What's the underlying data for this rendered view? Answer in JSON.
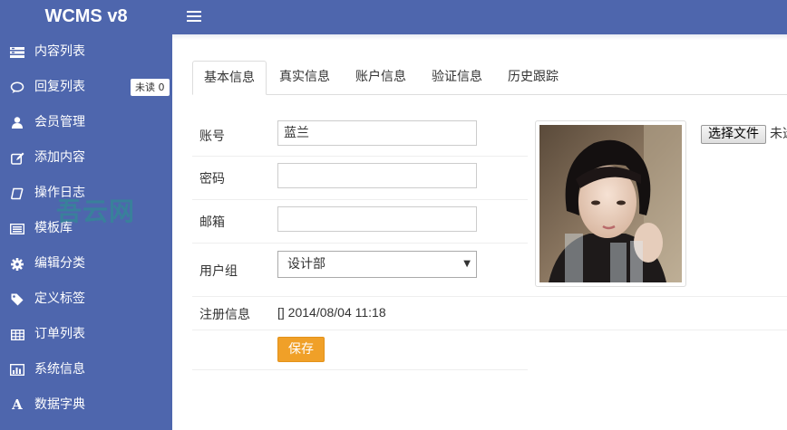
{
  "app": {
    "title": "WCMS v8"
  },
  "sidebar": {
    "items": [
      {
        "label": "内容列表",
        "icon": "list-icon"
      },
      {
        "label": "回复列表",
        "icon": "comment-icon",
        "badge": "未读 0"
      },
      {
        "label": "会员管理",
        "icon": "user-icon"
      },
      {
        "label": "添加内容",
        "icon": "edit-icon"
      },
      {
        "label": "操作日志",
        "icon": "log-icon"
      },
      {
        "label": "模板库",
        "icon": "template-icon"
      },
      {
        "label": "编辑分类",
        "icon": "gear-icon"
      },
      {
        "label": "定义标签",
        "icon": "tag-icon"
      },
      {
        "label": "订单列表",
        "icon": "table-icon"
      },
      {
        "label": "系统信息",
        "icon": "bar-chart-icon"
      },
      {
        "label": "数据字典",
        "icon": "font-icon"
      }
    ]
  },
  "watermark": "吾云网",
  "tabs": [
    {
      "label": "基本信息",
      "active": true
    },
    {
      "label": "真实信息",
      "active": false
    },
    {
      "label": "账户信息",
      "active": false
    },
    {
      "label": "验证信息",
      "active": false
    },
    {
      "label": "历史跟踪",
      "active": false
    }
  ],
  "form": {
    "account": {
      "label": "账号",
      "value": "蓝兰"
    },
    "password": {
      "label": "密码",
      "value": ""
    },
    "email": {
      "label": "邮箱",
      "value": ""
    },
    "group": {
      "label": "用户组",
      "value": "设计部"
    },
    "register": {
      "label": "注册信息",
      "value": "[] 2014/08/04 11:18"
    },
    "save_label": "保存"
  },
  "upload": {
    "button_label": "选择文件",
    "status": "未选择任何文件"
  },
  "colors": {
    "primary": "#4e66ad",
    "accent": "#f0a028"
  }
}
